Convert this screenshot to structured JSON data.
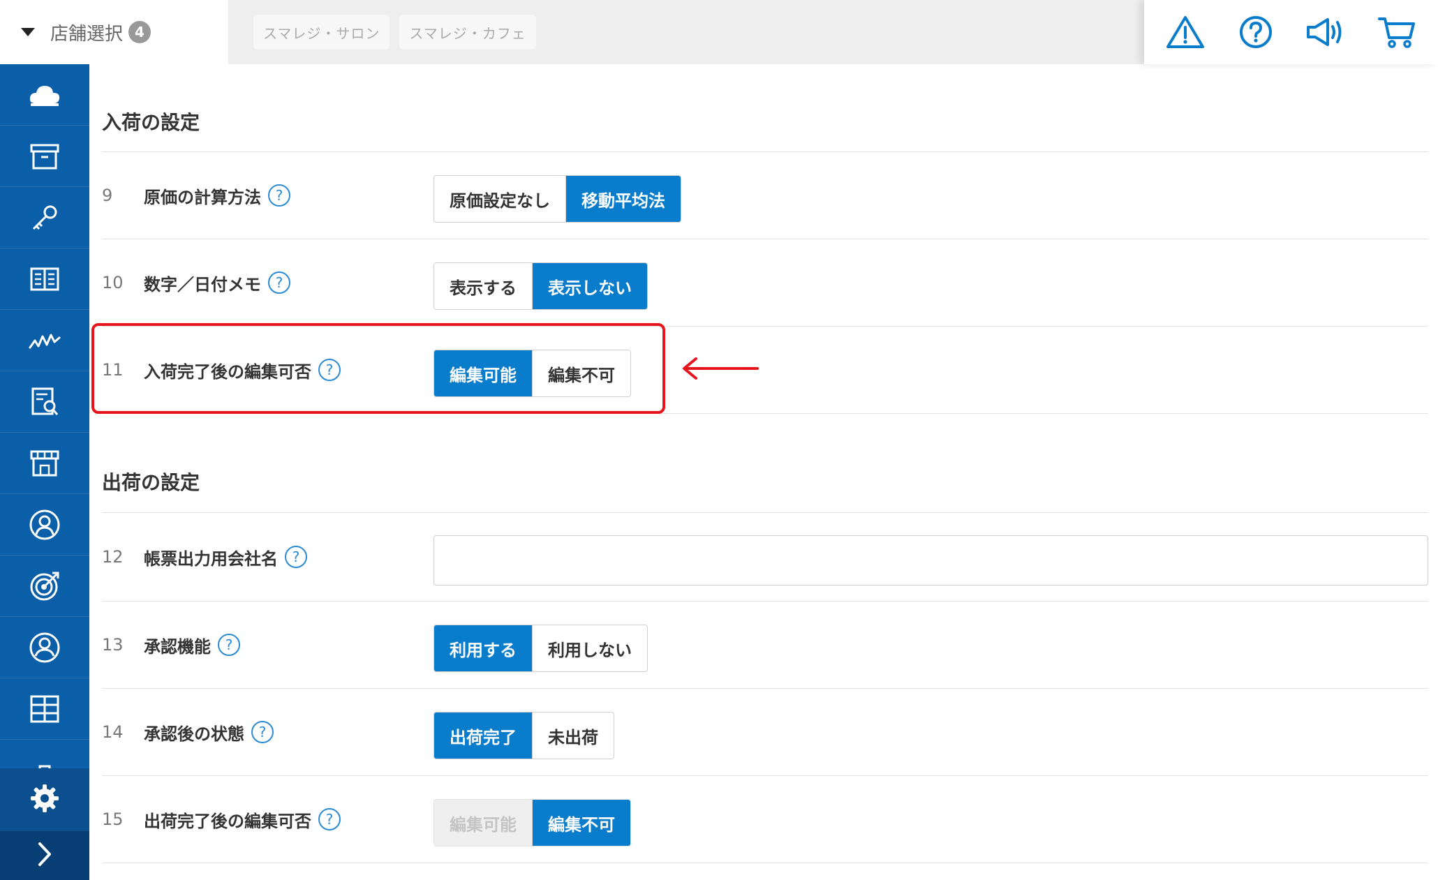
{
  "store_selector": {
    "label": "店舗選択",
    "count": "4",
    "tabs": [
      "スマレジ・サロン",
      "スマレジ・カフェ"
    ]
  },
  "top_icons": [
    "warning-icon",
    "help-circle-icon",
    "megaphone-icon",
    "cart-icon"
  ],
  "sidebar": {
    "items": [
      "cloud-icon",
      "archive-box-icon",
      "key-icon",
      "book-icon",
      "chart-line-icon",
      "report-search-icon",
      "store-icon",
      "customer-icon",
      "target-icon",
      "user-icon",
      "grid-icon",
      "briefcase-icon"
    ],
    "settings": "gear-icon",
    "expand": "chevron-right-icon"
  },
  "colors": {
    "sidebar": "#0a5fa8",
    "accent": "#0a7ccc",
    "highlight": "#e8141d"
  },
  "receiving": {
    "title": "入荷の設定",
    "rows": [
      {
        "num": "9",
        "label": "原価の計算方法",
        "options": [
          "原価設定なし",
          "移動平均法"
        ],
        "selected": 1
      },
      {
        "num": "10",
        "label": "数字／日付メモ",
        "options": [
          "表示する",
          "表示しない"
        ],
        "selected": 1
      },
      {
        "num": "11",
        "label": "入荷完了後の編集可否",
        "options": [
          "編集可能",
          "編集不可"
        ],
        "selected": 0
      }
    ]
  },
  "shipping": {
    "title": "出荷の設定",
    "rows": [
      {
        "num": "12",
        "label": "帳票出力用会社名",
        "value": ""
      },
      {
        "num": "13",
        "label": "承認機能",
        "options": [
          "利用する",
          "利用しない"
        ],
        "selected": 0
      },
      {
        "num": "14",
        "label": "承認後の状態",
        "options": [
          "出荷完了",
          "未出荷"
        ],
        "selected": 0
      },
      {
        "num": "15",
        "label": "出荷完了後の編集可否",
        "options": [
          "編集可能",
          "編集不可"
        ],
        "selected": 1,
        "disabled": [
          0
        ]
      }
    ]
  },
  "help_mark": "?"
}
